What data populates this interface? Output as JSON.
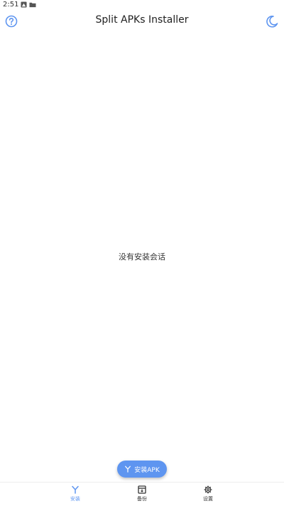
{
  "status_bar": {
    "time": "2:51",
    "icons": [
      "notification-icon",
      "folder-icon"
    ]
  },
  "app_bar": {
    "title": "Split APKs Installer",
    "left_icon": "help-icon",
    "right_icon": "moon-icon"
  },
  "main": {
    "empty_message": "没有安装会话"
  },
  "fab": {
    "label": "安装APK",
    "icon": "split-icon"
  },
  "bottom_nav": {
    "items": [
      {
        "label": "安装",
        "icon": "split-icon",
        "active": true
      },
      {
        "label": "备份",
        "icon": "archive-icon",
        "active": false
      },
      {
        "label": "设置",
        "icon": "gear-icon",
        "active": false
      }
    ]
  },
  "colors": {
    "accent": "#5e95f0",
    "text": "#212121",
    "background": "#ffffff"
  }
}
